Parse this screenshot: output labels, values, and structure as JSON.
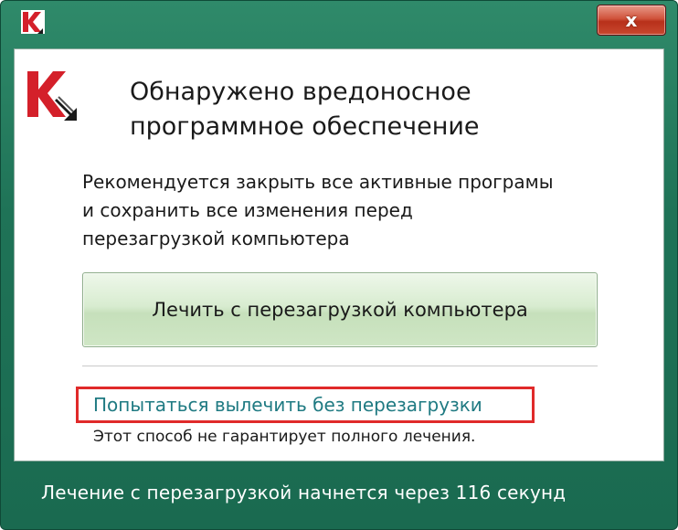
{
  "window": {
    "close_label": "x"
  },
  "dialog": {
    "heading_lines": [
      "Обнаружено вредоносное",
      "программное обеспечение"
    ],
    "recommendation_lines": [
      "Рекомендуется закрыть все активные програмы",
      "и сохранить все изменения перед",
      "перезагрузкой компьютера"
    ],
    "cure_button_label": "Лечить с перезагрузкой компьютера",
    "try_link_label": "Попытаться вылечить без перезагрузки",
    "note": "Этот способ не гарантирует полного лечения."
  },
  "footer": {
    "countdown_text": "Лечение с перезагрузкой начнется через 116 секунд"
  },
  "colors": {
    "window_frame": "#1f7357",
    "cure_button": "#d8ecd0",
    "link": "#1f7a82",
    "highlight_box": "#e02a2a",
    "close_button": "#c8482f"
  },
  "icons": {
    "title": "kaspersky-logo-icon",
    "main": "kaspersky-logo-icon"
  }
}
